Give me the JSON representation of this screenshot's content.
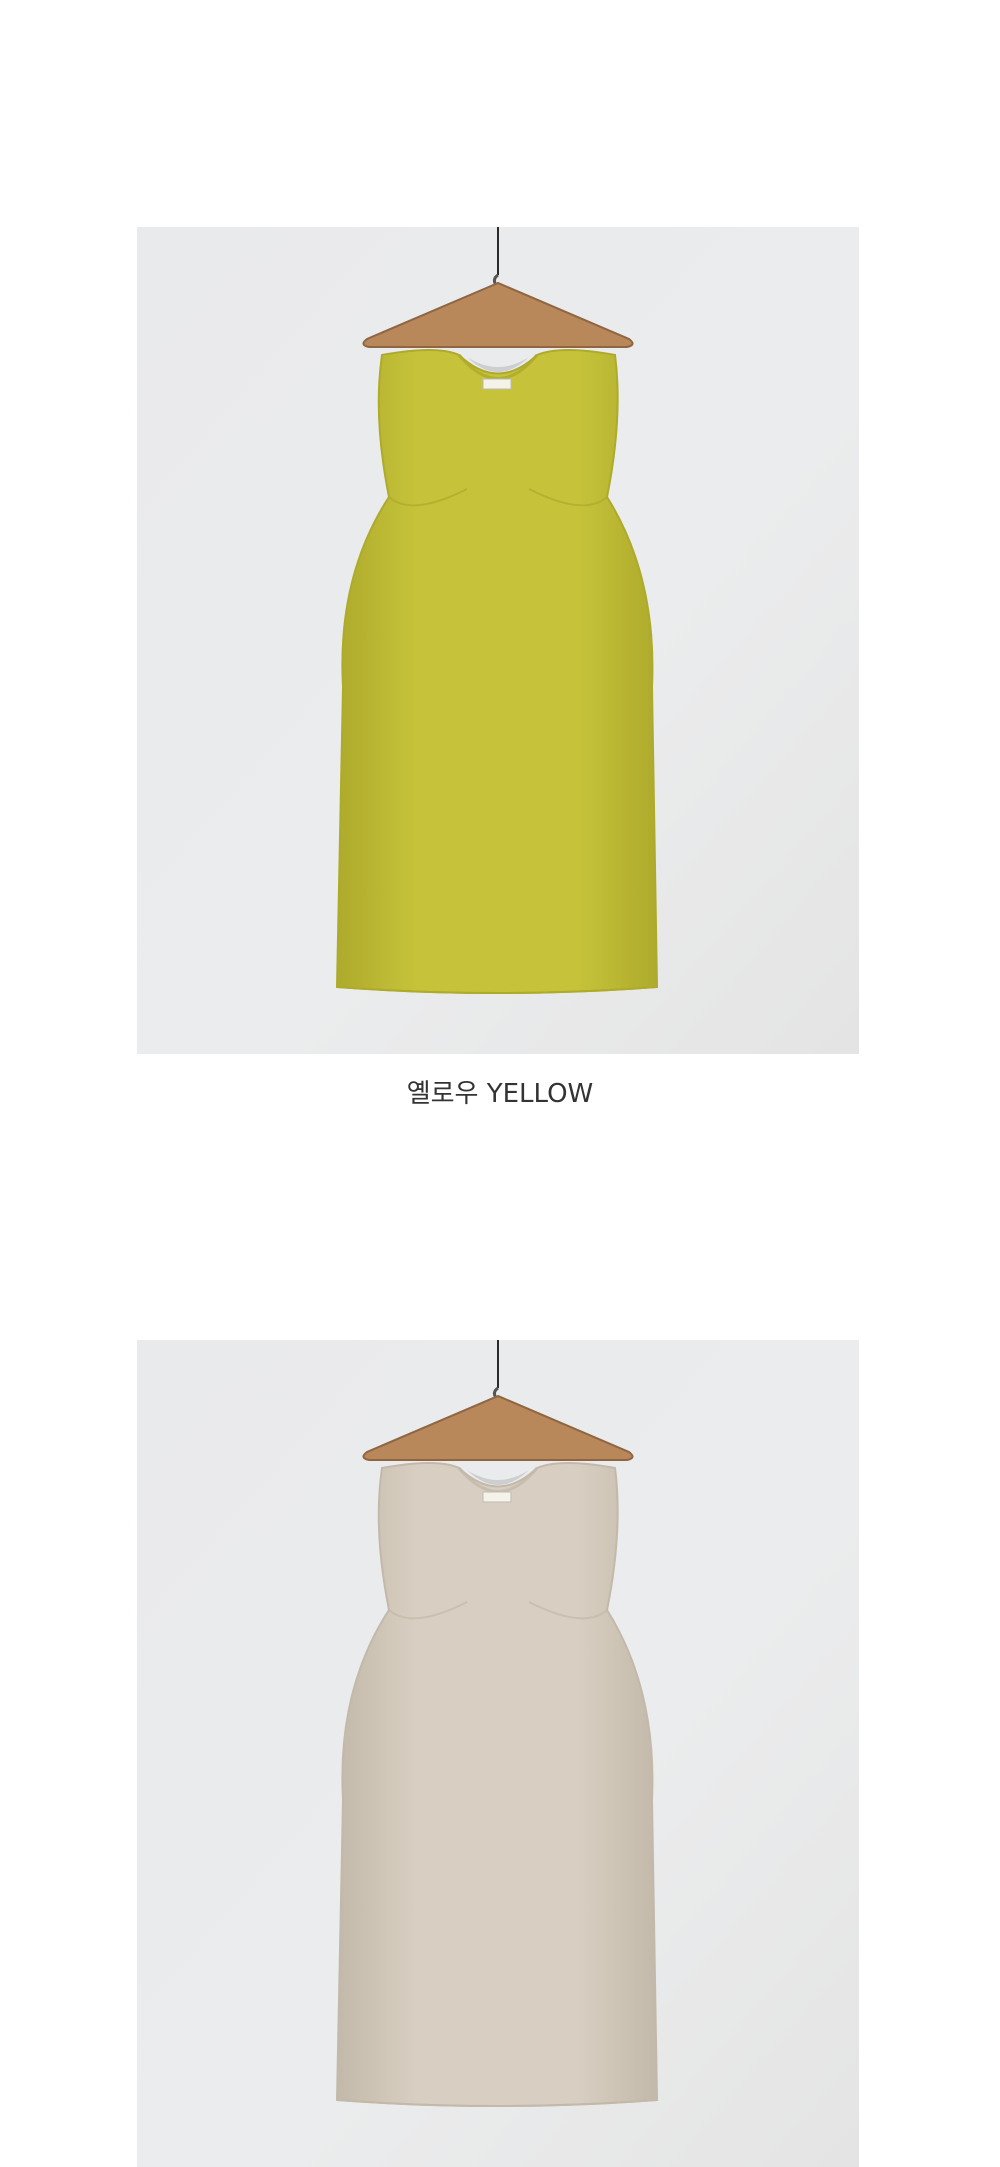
{
  "products": [
    {
      "color_label": "옐로우 YELLOW",
      "garment_color": "#c6c33a",
      "garment_shade": "#aeaa2c",
      "image_name": "yellow-sleeveless-dress-photo"
    },
    {
      "color_label": "",
      "garment_color": "#d8cfc2",
      "garment_shade": "#c3b9aa",
      "image_name": "beige-sleeveless-dress-photo"
    }
  ],
  "background_wall": "#ebeced"
}
